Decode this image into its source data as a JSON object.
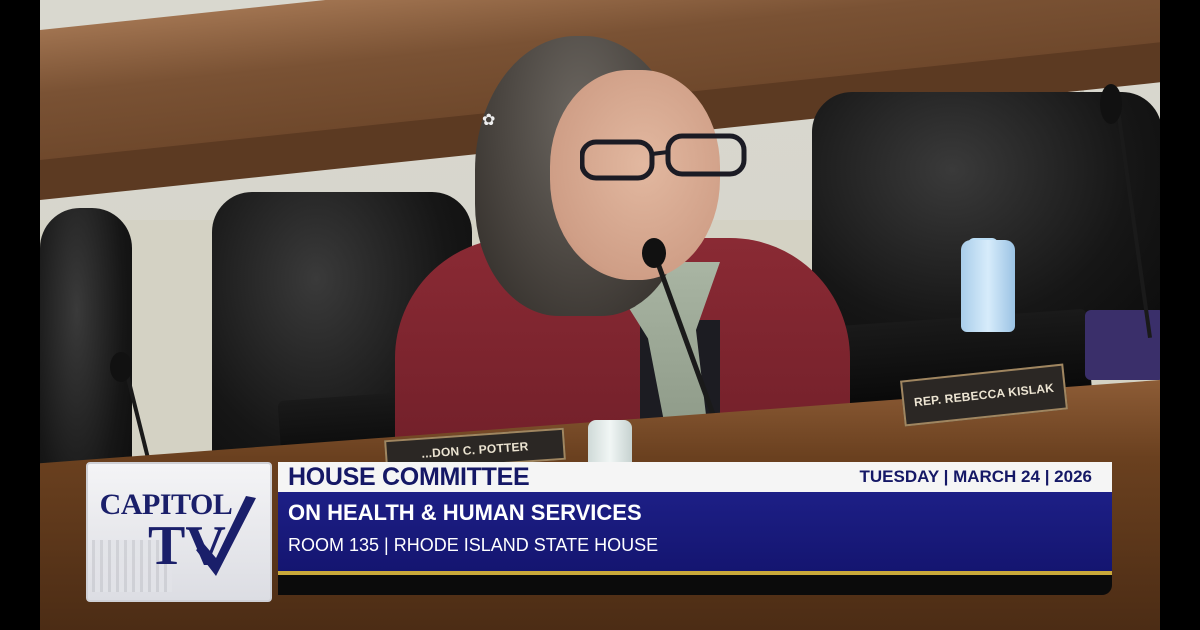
{
  "broadcast": {
    "logo": {
      "line1": "CAPITOL",
      "line2": "TV"
    },
    "title": "HOUSE COMMITTEE",
    "date": "TUESDAY | MARCH 24 | 2026",
    "committee": "ON HEALTH & HUMAN SERVICES",
    "location": "ROOM 135 | RHODE ISLAND STATE HOUSE",
    "colors": {
      "navy": "#1d1f86",
      "title_text": "#151866",
      "gold": "#c9a83a"
    }
  },
  "scene": {
    "nameplate_main": "REP. REBECCA KISLAK",
    "nameplate_left": "...DON C. POTTER"
  }
}
